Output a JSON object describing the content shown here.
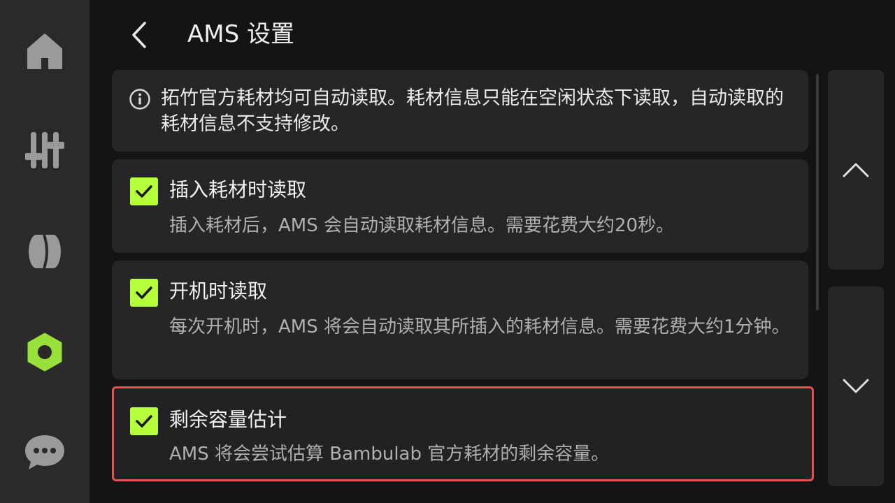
{
  "header": {
    "title": "AMS 设置"
  },
  "sidebar": {
    "items": [
      {
        "icon": "home-icon"
      },
      {
        "icon": "sliders-icon"
      },
      {
        "icon": "filament-icon"
      },
      {
        "icon": "settings-nut-icon",
        "active": true
      },
      {
        "icon": "chat-icon"
      }
    ],
    "active_color": "#9ae03a",
    "inactive_color": "#9a9a9a"
  },
  "info": {
    "text": "拓竹官方耗材均可自动读取。耗材信息只能在空闲状态下读取，自动读取的耗材信息不支持修改。"
  },
  "options": [
    {
      "title": "插入耗材时读取",
      "desc": "插入耗材后，AMS 会自动读取耗材信息。需要花费大约20秒。",
      "checked": true
    },
    {
      "title": "开机时读取",
      "desc": "每次开机时，AMS 将会自动读取其所插入的耗材信息。需要花费大约1分钟。",
      "checked": true
    },
    {
      "title": "剩余容量估计",
      "desc": "AMS 将会尝试估算 Bambulab 官方耗材的剩余容量。",
      "checked": true
    }
  ],
  "colors": {
    "accent": "#b6ff3c",
    "highlight_border": "#e8524e",
    "card_bg": "#262626"
  }
}
